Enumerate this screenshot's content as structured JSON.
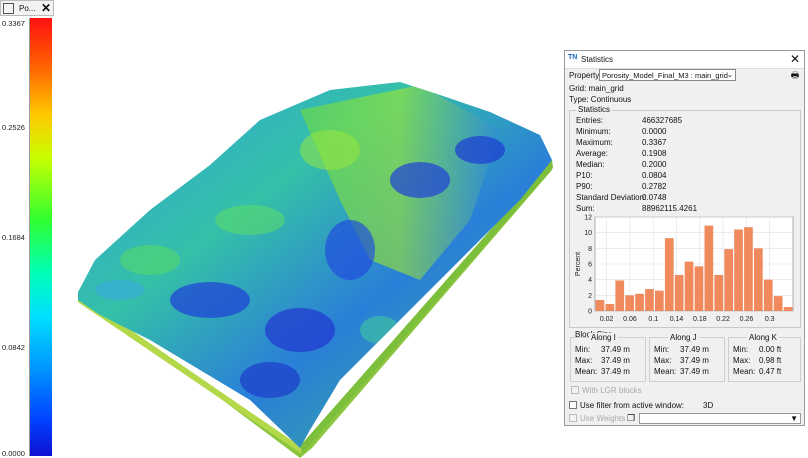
{
  "legend": {
    "title": "Po...",
    "close_label": "✕",
    "ticks": [
      "0.3367",
      "0.2526",
      "0.1684",
      "0.0842",
      "0.0000"
    ]
  },
  "stats": {
    "window_title": "Statistics",
    "app_icon_text": "TN",
    "close_label": "✕",
    "property_label": "Property:",
    "property_value": "Porosity_Model_Final_M3 : main_grid",
    "grid_text": "Grid: main_grid",
    "type_text": "Type: Continuous",
    "statistics_group": "Statistics",
    "rows": [
      {
        "label": "Entries:",
        "value": "466327685"
      },
      {
        "label": "Minimum:",
        "value": "0.0000"
      },
      {
        "label": "Maximum:",
        "value": "0.3367"
      },
      {
        "label": "Average:",
        "value": "0.1908"
      },
      {
        "label": "Median:",
        "value": "0.2000"
      },
      {
        "label": "P10:",
        "value": "0.0804"
      },
      {
        "label": "P90:",
        "value": "0.2782"
      },
      {
        "label": "Standard Deviation:",
        "value": "0.0748"
      },
      {
        "label": "Sum:",
        "value": "88962115.4261"
      }
    ],
    "block_size_group": "Block Size",
    "block_size": [
      {
        "header": "Along I",
        "min": "37.49 m",
        "max": "37.49 m",
        "mean": "37.49 m"
      },
      {
        "header": "Along J",
        "min": "37.49 m",
        "max": "37.49 m",
        "mean": "37.49 m"
      },
      {
        "header": "Along K",
        "min": "0.00 ft",
        "max": "0.98 ft",
        "mean": "0.47 ft"
      }
    ],
    "row_labels": {
      "min": "Min:",
      "max": "Max:",
      "mean": "Mean:"
    },
    "lgr_label": "With LGR blocks",
    "filter_label": "Use filter from active window:",
    "filter_value": "3D",
    "weights_label": "Use Weights"
  },
  "chart_data": {
    "type": "bar",
    "ylabel": "Percent",
    "xlabel": "",
    "ylim": [
      0,
      12
    ],
    "yticks": [
      "12",
      "10",
      "8",
      "6",
      "4",
      "2",
      "0"
    ],
    "xticks": [
      "0.02",
      "0.06",
      "0.1",
      "0.14",
      "0.18",
      "0.22",
      "0.26",
      "0.3"
    ],
    "xlim": [
      0.0,
      0.34
    ],
    "bin_starts": [
      0.0,
      0.017,
      0.034,
      0.051,
      0.068,
      0.085,
      0.102,
      0.119,
      0.136,
      0.153,
      0.17,
      0.187,
      0.204,
      0.221,
      0.238,
      0.255,
      0.272,
      0.289,
      0.306,
      0.323
    ],
    "bin_width": 0.017,
    "values": [
      1.4,
      0.9,
      3.9,
      2.0,
      2.2,
      2.8,
      2.6,
      9.3,
      4.6,
      6.3,
      5.7,
      10.9,
      4.6,
      7.9,
      10.4,
      10.7,
      8.0,
      4.0,
      1.9,
      0.5
    ],
    "bar_color": "#f08a5d",
    "grid": true
  },
  "colors": {
    "bar": "#f08a5d",
    "surface_base": "#9acd32"
  }
}
